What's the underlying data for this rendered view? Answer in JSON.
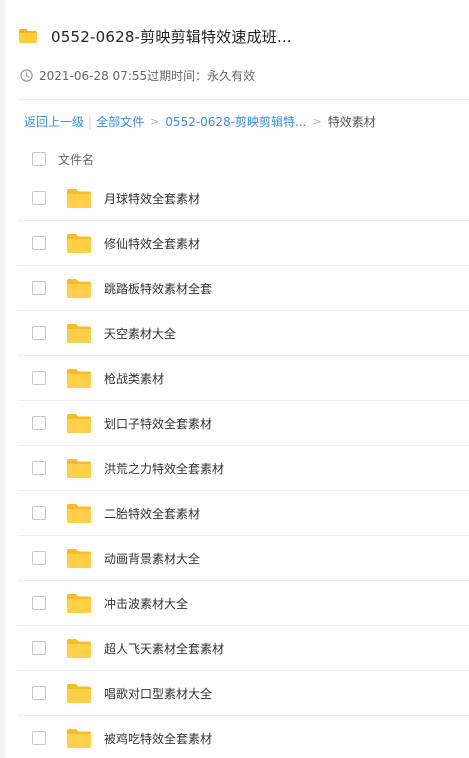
{
  "header": {
    "folder_icon": "folder-icon",
    "title": "0552-0628-剪映剪辑特效速成班..."
  },
  "meta": {
    "clock_icon": "clock-icon",
    "text": "2021-06-28 07:55过期时间：永久有效"
  },
  "breadcrumb": {
    "back": "返回上一级",
    "all_files": "全部文件",
    "parent": "0552-0628-剪映剪辑特...",
    "current": "特效素材"
  },
  "list": {
    "column_name": "文件名",
    "items": [
      {
        "name": "月球特效全套素材"
      },
      {
        "name": "修仙特效全套素材"
      },
      {
        "name": "跳踏板特效素材全套"
      },
      {
        "name": "天空素材大全"
      },
      {
        "name": "枪战类素材"
      },
      {
        "name": "划口子特效全套素材"
      },
      {
        "name": "洪荒之力特效全套素材"
      },
      {
        "name": "二胎特效全套素材"
      },
      {
        "name": "动画背景素材大全"
      },
      {
        "name": "冲击波素材大全"
      },
      {
        "name": "超人飞天素材全套素材"
      },
      {
        "name": "唱歌对口型素材大全"
      },
      {
        "name": "被鸡吃特效全套素材"
      }
    ]
  },
  "colors": {
    "folder": "#ffc53d",
    "link": "#3a8ee6"
  }
}
